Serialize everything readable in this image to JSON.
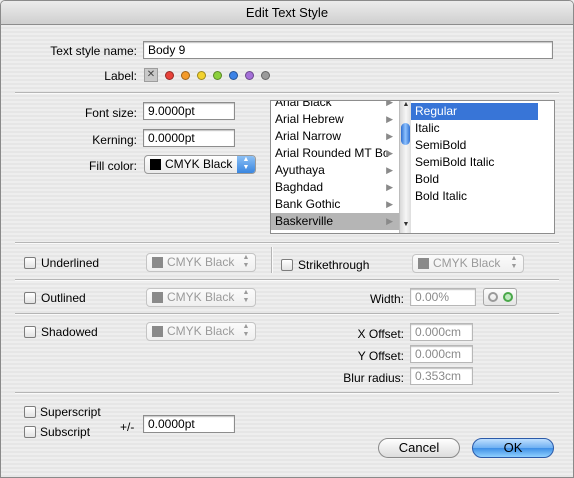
{
  "window": {
    "title": "Edit Text Style"
  },
  "style_name": {
    "label": "Text style name:",
    "value": "Body 9"
  },
  "label_row": {
    "label": "Label:",
    "none_glyph": "✕",
    "colors": [
      "#e8423a",
      "#f39a2b",
      "#f2d22e",
      "#8bd03b",
      "#3b82e6",
      "#a46fd8",
      "#9a9a9a"
    ]
  },
  "font_size": {
    "label": "Font size:",
    "value": "9.0000pt"
  },
  "kerning": {
    "label": "Kerning:",
    "value": "0.0000pt"
  },
  "fill_color": {
    "label": "Fill color:",
    "value": "CMYK Black",
    "swatch": "#000000"
  },
  "font_list": {
    "items": [
      "Arial Black",
      "Arial Hebrew",
      "Arial Narrow",
      "Arial Rounded MT Bo",
      "Ayuthaya",
      "Baghdad",
      "Bank Gothic",
      "Baskerville"
    ],
    "selected": "Baskerville"
  },
  "style_list": {
    "items": [
      "Regular",
      "Italic",
      "SemiBold",
      "SemiBold Italic",
      "Bold",
      "Bold Italic"
    ],
    "selected": "Regular"
  },
  "underlined": {
    "label": "Underlined",
    "color": "CMYK Black"
  },
  "strikethrough": {
    "label": "Strikethrough",
    "color": "CMYK Black"
  },
  "outlined": {
    "label": "Outlined",
    "color": "CMYK Black",
    "width_label": "Width:",
    "width_value": "0.00%"
  },
  "shadowed": {
    "label": "Shadowed",
    "color": "CMYK Black",
    "x_offset_label": "X Offset:",
    "x_offset": "0.000cm",
    "y_offset_label": "Y Offset:",
    "y_offset": "0.000cm",
    "blur_label": "Blur radius:",
    "blur": "0.353cm"
  },
  "superscript": {
    "label": "Superscript"
  },
  "subscript": {
    "label": "Subscript"
  },
  "offset": {
    "label": "+/-",
    "value": "0.0000pt"
  },
  "buttons": {
    "cancel": "Cancel",
    "ok": "OK"
  },
  "disabled_swatch": "#8a8a8a"
}
